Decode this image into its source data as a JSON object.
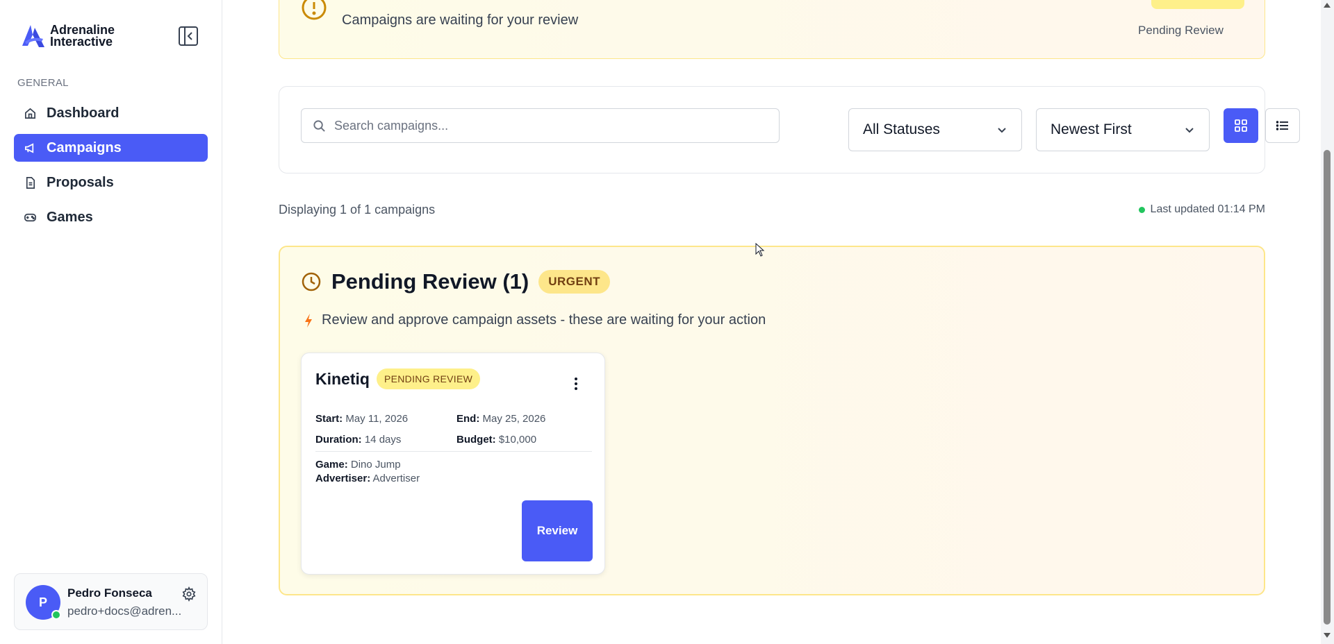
{
  "brand": {
    "line1": "Adrenaline",
    "line2": "Interactive"
  },
  "sidebar": {
    "section_label": "GENERAL",
    "items": [
      {
        "label": "Dashboard",
        "icon": "home-icon",
        "active": false
      },
      {
        "label": "Campaigns",
        "icon": "megaphone-icon",
        "active": true
      },
      {
        "label": "Proposals",
        "icon": "document-icon",
        "active": false
      },
      {
        "label": "Games",
        "icon": "gamepad-icon",
        "active": false
      }
    ]
  },
  "user": {
    "initial": "P",
    "name": "Pedro Fonseca",
    "email": "pedro+docs@adren..."
  },
  "banner": {
    "text": "Campaigns are waiting for your review",
    "badge_label": "Pending Review"
  },
  "filters": {
    "search_placeholder": "Search campaigns...",
    "status_selected": "All Statuses",
    "sort_selected": "Newest First"
  },
  "summary": {
    "displaying": "Displaying 1 of 1 campaigns",
    "last_updated": "Last updated 01:14 PM"
  },
  "pending": {
    "title": "Pending Review (1)",
    "badge": "URGENT",
    "subtitle": "Review and approve campaign assets - these are waiting for your action"
  },
  "campaign": {
    "name": "Kinetiq",
    "status": "PENDING REVIEW",
    "start_label": "Start:",
    "start": "May 11, 2026",
    "end_label": "End:",
    "end": "May 25, 2026",
    "duration_label": "Duration:",
    "duration": "14 days",
    "budget_label": "Budget:",
    "budget": "$10,000",
    "game_label": "Game:",
    "game": "Dino Jump",
    "advertiser_label": "Advertiser:",
    "advertiser": "Advertiser",
    "review_label": "Review"
  },
  "colors": {
    "accent": "#4a5bf6",
    "warning_bg": "#fefce8",
    "warning_border": "#fde68a",
    "online": "#22c55e"
  }
}
